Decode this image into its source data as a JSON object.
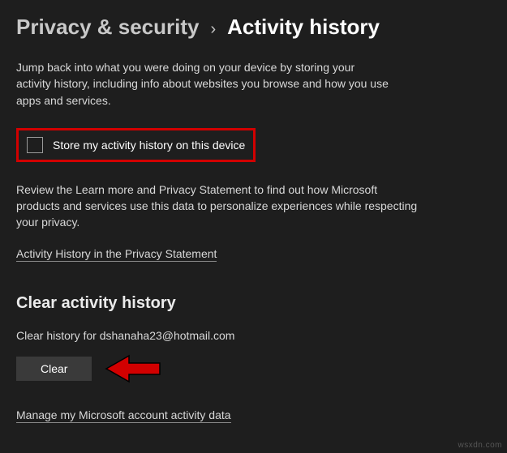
{
  "breadcrumb": {
    "parent": "Privacy & security",
    "current": "Activity history"
  },
  "intro": "Jump back into what you were doing on your device by storing your activity history, including info about websites you browse and how you use apps and services.",
  "store_checkbox": {
    "label": "Store my activity history on this device",
    "checked": false
  },
  "review_text": "Review the Learn more and Privacy Statement to find out how Microsoft products and services use this data to personalize experiences while respecting your privacy.",
  "privacy_link": "Activity History in the Privacy Statement",
  "clear_section": {
    "title": "Clear activity history",
    "clear_for": "Clear history for dshanaha23@hotmail.com",
    "button": "Clear"
  },
  "manage_link": "Manage my Microsoft account activity data",
  "watermark": "wsxdn.com"
}
